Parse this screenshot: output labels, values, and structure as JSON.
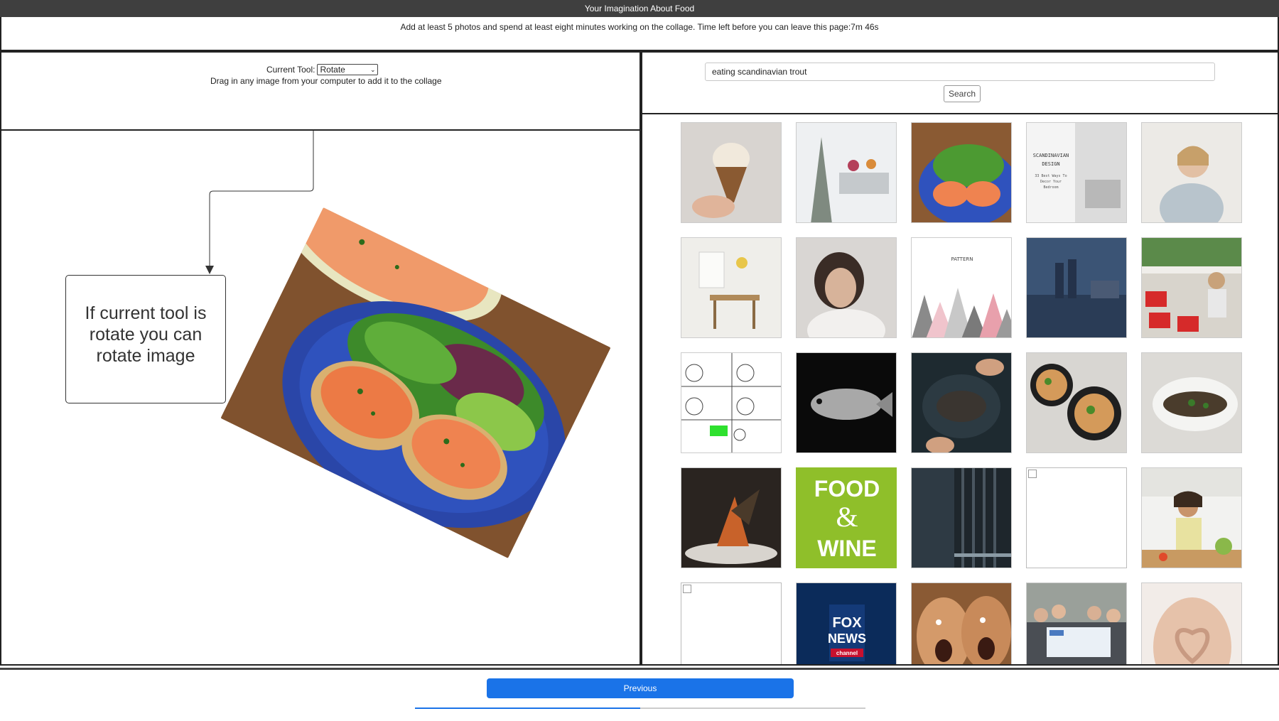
{
  "window": {
    "title": "Your Imagination About Food"
  },
  "instruction": "Add at least 5 photos and spend at least eight minutes working on the collage. Time left before you can leave this page:7m 46s",
  "tool": {
    "label": "Current Tool:",
    "selected": "Rotate",
    "hint": "Drag in any image from your computer to add it to the collage"
  },
  "annotation": {
    "lines": [
      "If current tool is",
      "rotate you can",
      "rotate image"
    ]
  },
  "canvas": {
    "photo_rotation_deg": 26
  },
  "search": {
    "query": "eating scandinavian trout",
    "button_label": "Search"
  },
  "results": {
    "items": [
      "ice-cream-cone",
      "winter-table",
      "salmon-plate",
      "scandinavian-design",
      "woman-thinking",
      "dining-room",
      "woman-face",
      "pattern",
      "harbor-city",
      "restaurant-red-chairs",
      "rage-comic",
      "fish-bw",
      "dark-fish-dish",
      "ramen-bowls",
      "fish-platter",
      "plated-dish",
      "food-wine-logo",
      "dark-door",
      "broken-image",
      "kitchen-chef",
      "broken-image",
      "fox-news-logo",
      "screaming-men",
      "group-check",
      "hands-heart-belly"
    ],
    "scandinavian_text": [
      "SCANDINAVIAN",
      "DESIGN",
      "33 Best Ways To",
      "Decor Your",
      "Bedroom"
    ],
    "pattern_text": "PATTERN",
    "food_wine_text": [
      "FOOD",
      "&",
      "WINE"
    ],
    "fox_text": [
      "FOX",
      "NEWS",
      "channel"
    ]
  },
  "footer": {
    "previous_label": "Previous",
    "progress_fraction": 0.5
  },
  "colors": {
    "title_bar": "#3f3f3f",
    "accent": "#1a73e8",
    "food_wine_green": "#8fbf2a",
    "fox_blue": "#0b2b5a"
  }
}
